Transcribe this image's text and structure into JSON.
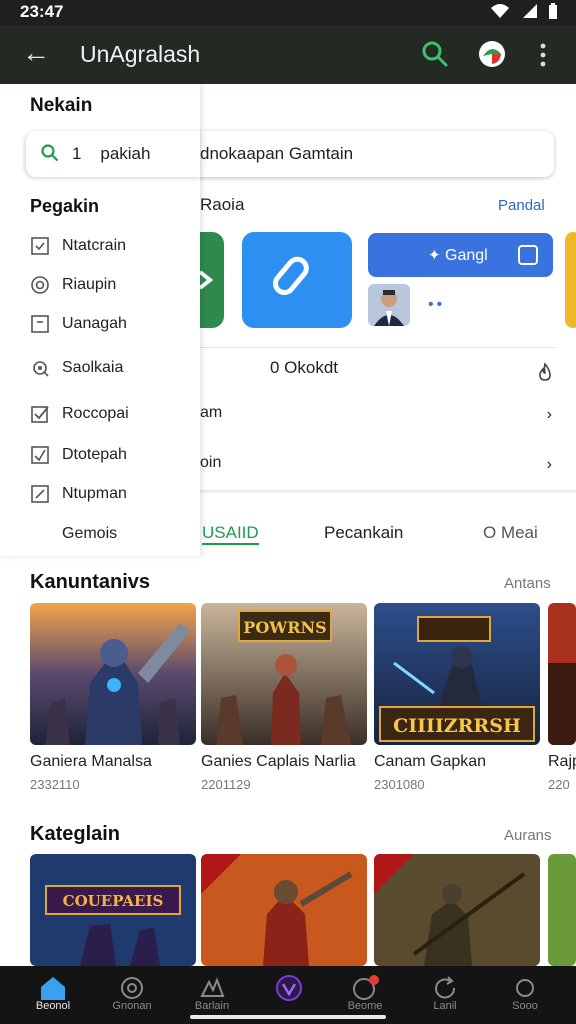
{
  "status": {
    "time": "23:47"
  },
  "app_bar": {
    "title": "UnAgralash"
  },
  "main_search": {
    "text": "dnokaapan Gamtain"
  },
  "popular": {
    "title": "Raoia",
    "action": "Pandal"
  },
  "install_button": {
    "label": "Gangl"
  },
  "stats": {
    "value": "0 Okokdt"
  },
  "rows": [
    {
      "label": "am"
    },
    {
      "label": "oin"
    }
  ],
  "drawer": {
    "title": "Nekain",
    "search": {
      "prefix": "1",
      "text": "pakiah"
    },
    "section_title": "Pegakin",
    "items": [
      {
        "label": "Ntatcrain",
        "icon": "checkbox-icon"
      },
      {
        "label": "Riaupin",
        "icon": "radio-target-icon"
      },
      {
        "label": "Uanagah",
        "icon": "square-minus-icon"
      },
      {
        "label": "Saolkaia",
        "icon": "settings-gear-icon"
      },
      {
        "label": "Roccopai",
        "icon": "checkbox-checked-icon"
      },
      {
        "label": "Dtotepah",
        "icon": "checkbox-tick-icon"
      },
      {
        "label": "Ntupman",
        "icon": "edit-square-icon"
      },
      {
        "label": "Gemois",
        "icon": ""
      }
    ]
  },
  "tabs": [
    {
      "label": "USAIID",
      "active": true
    },
    {
      "label": "Pecankain",
      "active": false
    },
    {
      "label": "O Meai",
      "active": false
    }
  ],
  "section1": {
    "title": "Kanuntanivs",
    "link": "Antans",
    "cards": [
      {
        "name": "Ganiera Manalsa",
        "meta": "2332110"
      },
      {
        "name": "Ganies Caplais Narlia",
        "meta": "2201129"
      },
      {
        "name": "Canam Gapkan",
        "meta": "2301080"
      },
      {
        "name": "Rajp",
        "meta": "220"
      }
    ]
  },
  "section2": {
    "title": "Kateglain",
    "link": "Aurans"
  },
  "game_art": {
    "card2_title": "POWRNS",
    "card3_title": "CIIIIZRRSH",
    "row2_card1_title": "COUEPAEIS"
  },
  "bottom_nav": [
    {
      "label": "Beonol",
      "icon": "home-icon",
      "active": true
    },
    {
      "label": "Gnonan",
      "icon": "apps-circle-icon",
      "active": false
    },
    {
      "label": "Barlain",
      "icon": "games-icon",
      "active": false
    },
    {
      "label": "",
      "icon": "purple-logo-icon",
      "active": false
    },
    {
      "label": "Beome",
      "icon": "notification-icon",
      "active": false
    },
    {
      "label": "Lanil",
      "icon": "refresh-icon",
      "active": false
    },
    {
      "label": "Sooo",
      "icon": "more-dots-icon",
      "active": false
    }
  ],
  "colors": {
    "app_bar": "#232a24",
    "accent_green": "#1e9b4d",
    "accent_blue": "#3a73e0",
    "nav_bg": "#141414"
  }
}
